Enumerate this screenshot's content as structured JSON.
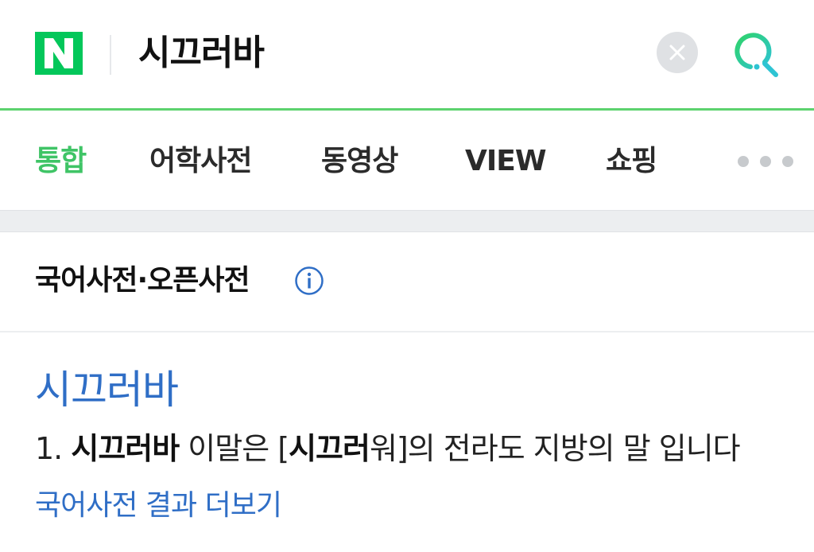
{
  "header": {
    "query": "시끄러바",
    "logo_letter": "N",
    "clear_icon": "close-icon",
    "search_icon": "search-icon"
  },
  "tabs": [
    {
      "label": "통합",
      "active": true
    },
    {
      "label": "어학사전",
      "active": false
    },
    {
      "label": "동영상",
      "active": false
    },
    {
      "label": "VIEW",
      "active": false
    },
    {
      "label": "쇼핑",
      "active": false
    }
  ],
  "more_icon": "more-dots-icon",
  "section": {
    "title": "국어사전·오픈사전",
    "info_icon": "info-icon"
  },
  "entry": {
    "word": "시끄러바",
    "definition": {
      "number": "1.",
      "term": "시끄러바",
      "text1": " 이말은 [",
      "bold_ref": "시끄러",
      "text2": "워]의 전라도 지방의 말 입니다"
    },
    "more_link": "국어사전 결과 더보기"
  },
  "colors": {
    "brand_green": "#03c75a",
    "active_tab": "#3fc466",
    "link_blue": "#2f6ec6"
  }
}
